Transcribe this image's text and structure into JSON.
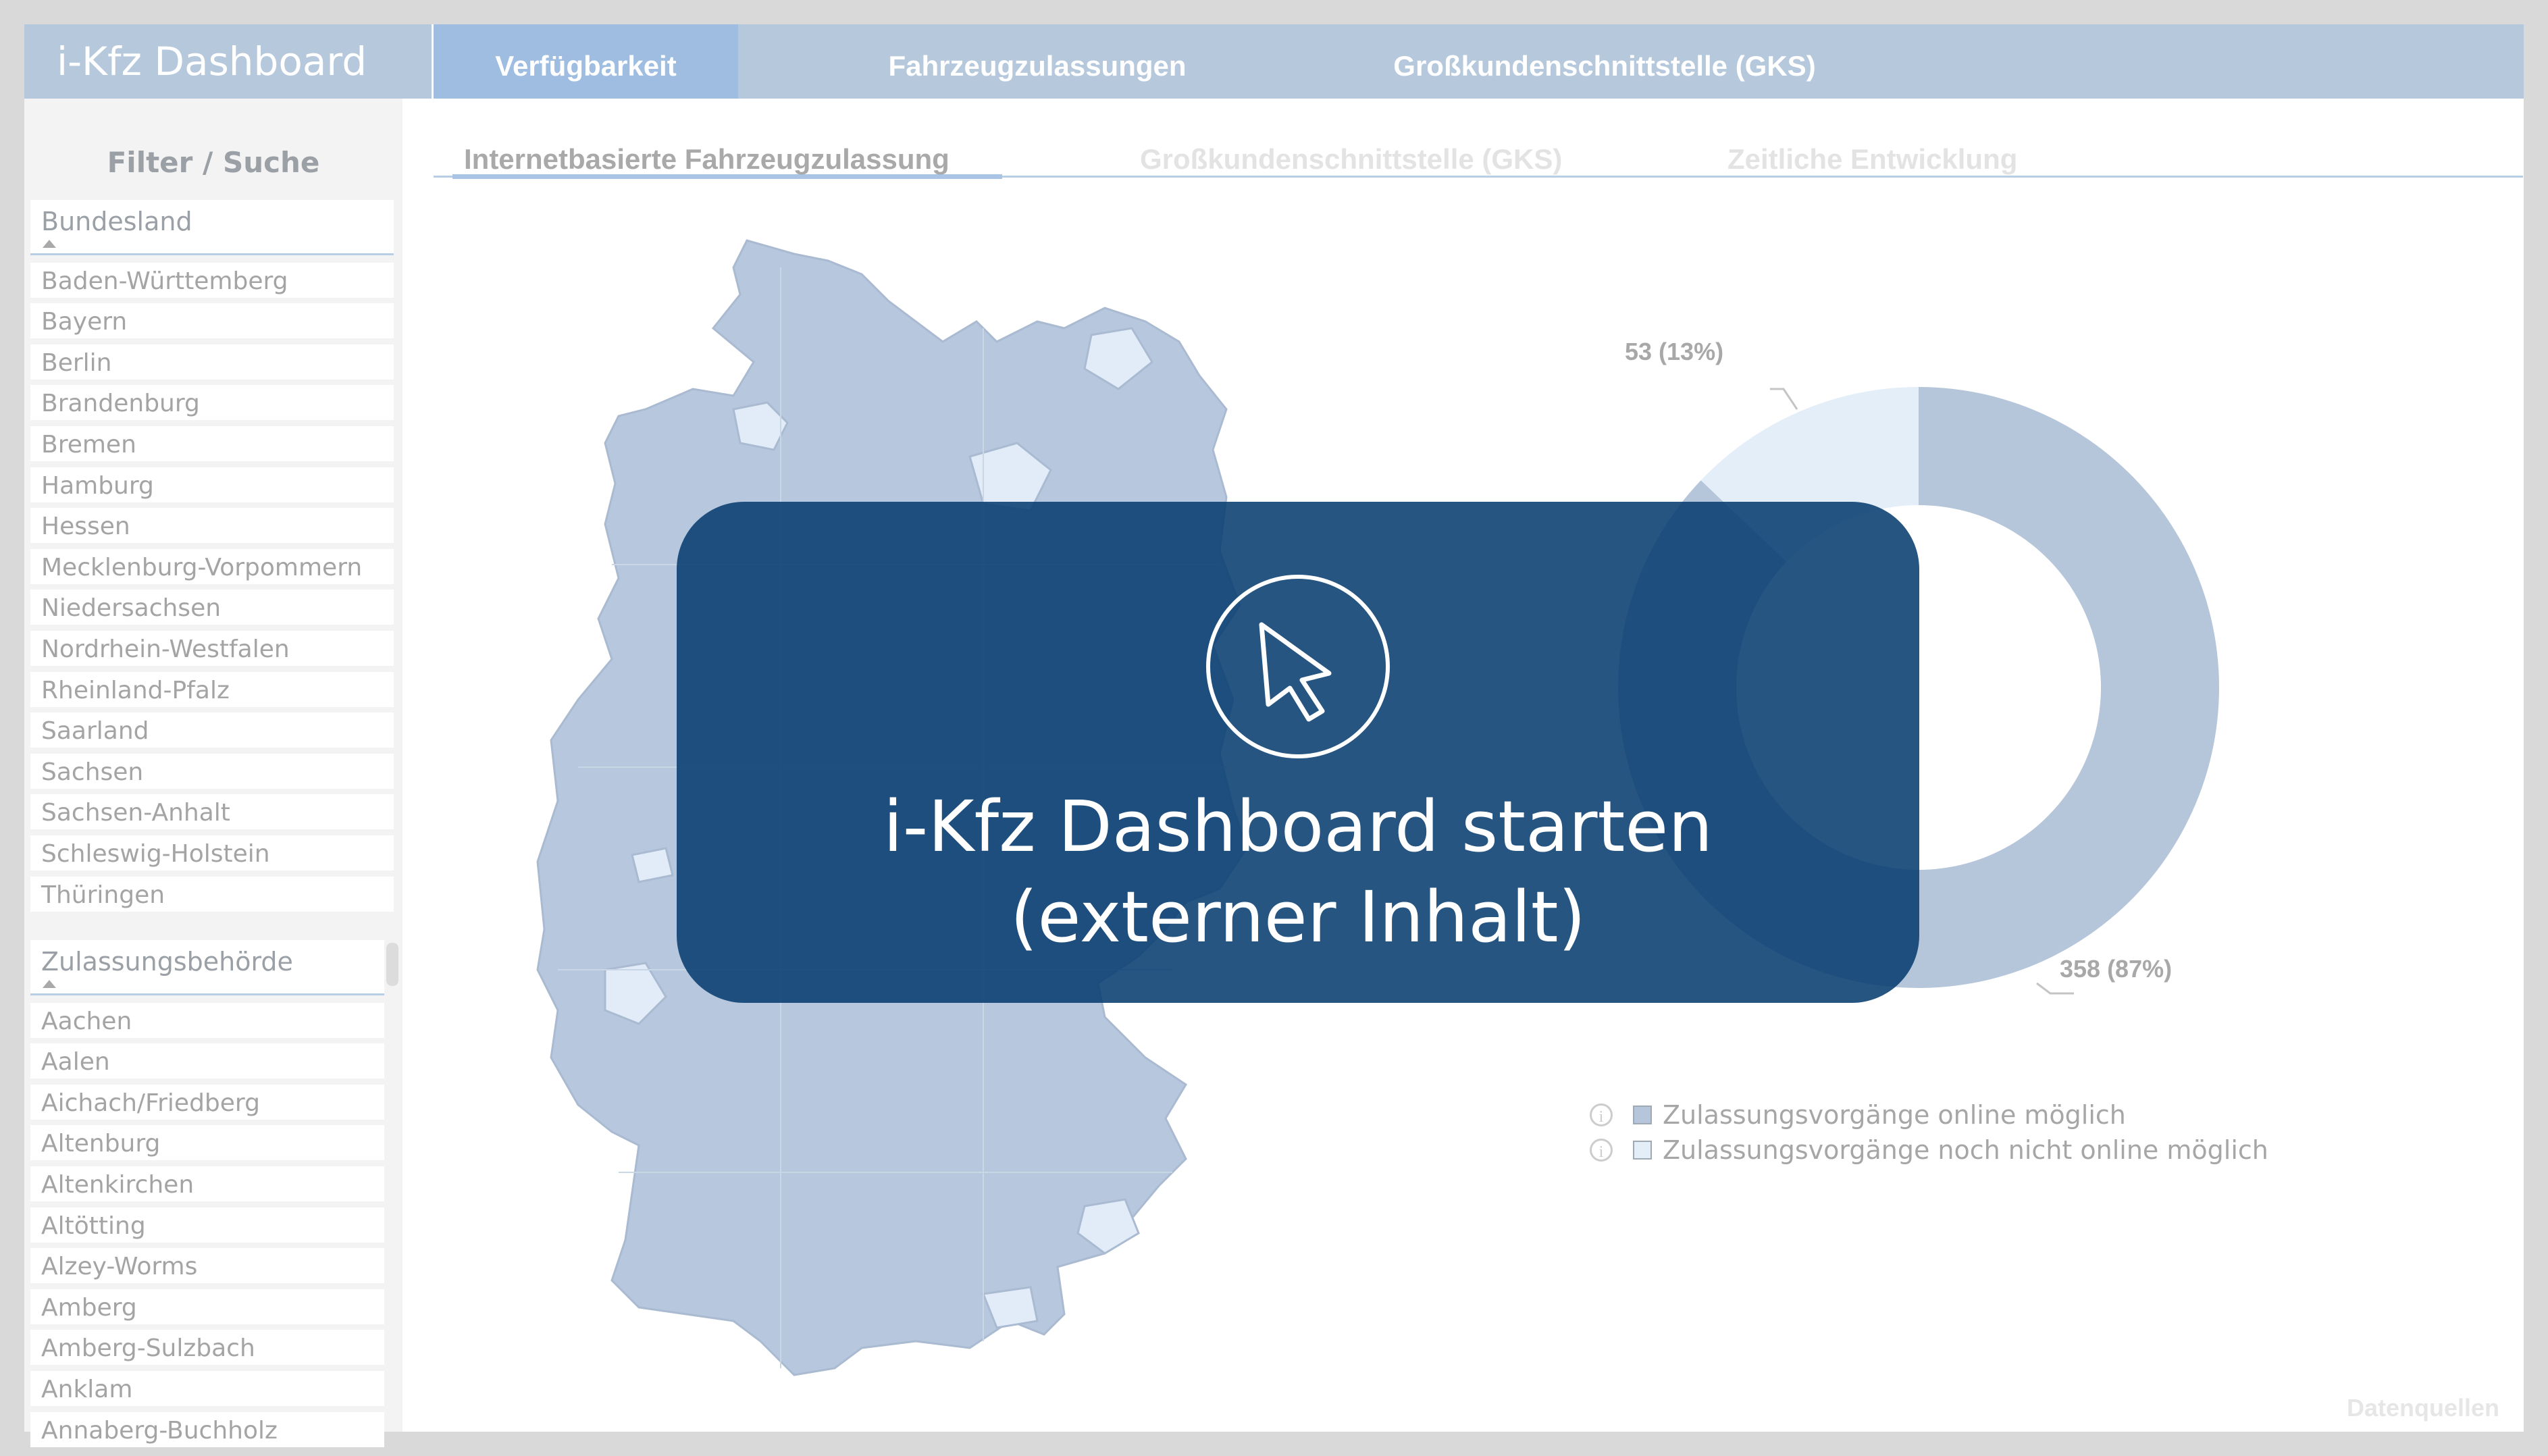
{
  "app": {
    "title": "i-Kfz Dashboard"
  },
  "top_tabs": [
    {
      "label": "Verfügbarkeit",
      "active": true
    },
    {
      "label": "Fahrzeugzulassungen",
      "active": false
    },
    {
      "label": "Großkundenschnittstelle (GKS)",
      "active": false
    }
  ],
  "sub_tabs": [
    {
      "label": "Internetbasierte Fahrzeugzulassung",
      "active": true
    },
    {
      "label": "Großkundenschnittstelle (GKS)",
      "active": false
    },
    {
      "label": "Zeitliche Entwicklung",
      "active": false
    }
  ],
  "sidebar": {
    "heading": "Filter / Suche",
    "bundesland": {
      "label": "Bundesland",
      "items": [
        "Baden-Württemberg",
        "Bayern",
        "Berlin",
        "Brandenburg",
        "Bremen",
        "Hamburg",
        "Hessen",
        "Mecklenburg-Vorpommern",
        "Niedersachsen",
        "Nordrhein-Westfalen",
        "Rheinland-Pfalz",
        "Saarland",
        "Sachsen",
        "Sachsen-Anhalt",
        "Schleswig-Holstein",
        "Thüringen"
      ]
    },
    "behoerde": {
      "label": "Zulassungsbehörde",
      "items": [
        "Aachen",
        "Aalen",
        "Aichach/Friedberg",
        "Altenburg",
        "Altenkirchen",
        "Altötting",
        "Alzey-Worms",
        "Amberg",
        "Amberg-Sulzbach",
        "Anklam",
        "Annaberg-Buchholz"
      ]
    }
  },
  "chart_data": {
    "type": "pie",
    "style": "donut",
    "categories": [
      "Zulassungsvorgänge online möglich",
      "Zulassungsvorgänge noch nicht online möglich"
    ],
    "values": [
      358,
      53
    ],
    "labels": [
      "358 (87%)",
      "53 (13%)"
    ],
    "colors": [
      "#b6c6da",
      "#e3eef9"
    ],
    "legend_position": "bottom"
  },
  "legend": {
    "info_glyph": "i",
    "items": [
      {
        "label": "Zulassungsvorgänge online möglich",
        "color": "#b6c6da"
      },
      {
        "label": "Zulassungsvorgänge noch nicht online möglich",
        "color": "#e3eef9"
      }
    ]
  },
  "footer": {
    "datenquellen": "Datenquellen"
  },
  "overlay": {
    "line1": "i-Kfz Dashboard starten",
    "line2": "(externer Inhalt)",
    "icon": "cursor-arrow-icon"
  },
  "map": {
    "fill": "#b7c7dd",
    "highlight": "#e1ecf8",
    "icon": "germany-map"
  }
}
